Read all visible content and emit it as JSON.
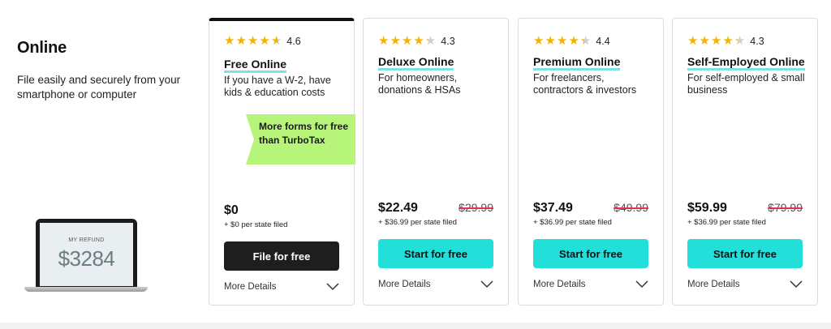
{
  "intro": {
    "title": "Online",
    "subtitle": "File easily and securely from your smartphone or computer"
  },
  "laptop": {
    "label": "MY REFUND",
    "amount": "$3284"
  },
  "cards": [
    {
      "rating": "4.6",
      "stars": [
        1,
        1,
        1,
        1,
        0.6
      ],
      "name": "Free Online",
      "desc": "If you have a W-2, have kids & education costs",
      "badge": "More forms for free than TurboTax",
      "price": "$0",
      "old_price": "",
      "state": "+  $0  per state filed",
      "button": "File for free",
      "details": "More Details"
    },
    {
      "rating": "4.3",
      "stars": [
        1,
        1,
        1,
        1,
        0.3
      ],
      "name": "Deluxe Online",
      "desc": "For homeowners, donations & HSAs",
      "price": "$22.49",
      "old_price": "$29.99",
      "state": "+  $36.99  per state filed",
      "button": "Start for free",
      "details": "More Details"
    },
    {
      "rating": "4.4",
      "stars": [
        1,
        1,
        1,
        1,
        0.4
      ],
      "name": "Premium Online",
      "desc": "For freelancers, contractors & investors",
      "price": "$37.49",
      "old_price": "$49.99",
      "state": "+  $36.99  per state filed",
      "button": "Start for free",
      "details": "More Details"
    },
    {
      "rating": "4.3",
      "stars": [
        1,
        1,
        1,
        1,
        0.3
      ],
      "name": "Self-Employed Online",
      "desc": "For self-employed & small business",
      "price": "$59.99",
      "old_price": "$79.99",
      "state": "+  $36.99  per state filed",
      "button": "Start for free",
      "details": "More Details"
    }
  ],
  "colors": {
    "accent_teal": "#22dfd9",
    "badge_green": "#b6f57a",
    "star_gold": "#f5b301",
    "strike_red": "#e0325a"
  }
}
